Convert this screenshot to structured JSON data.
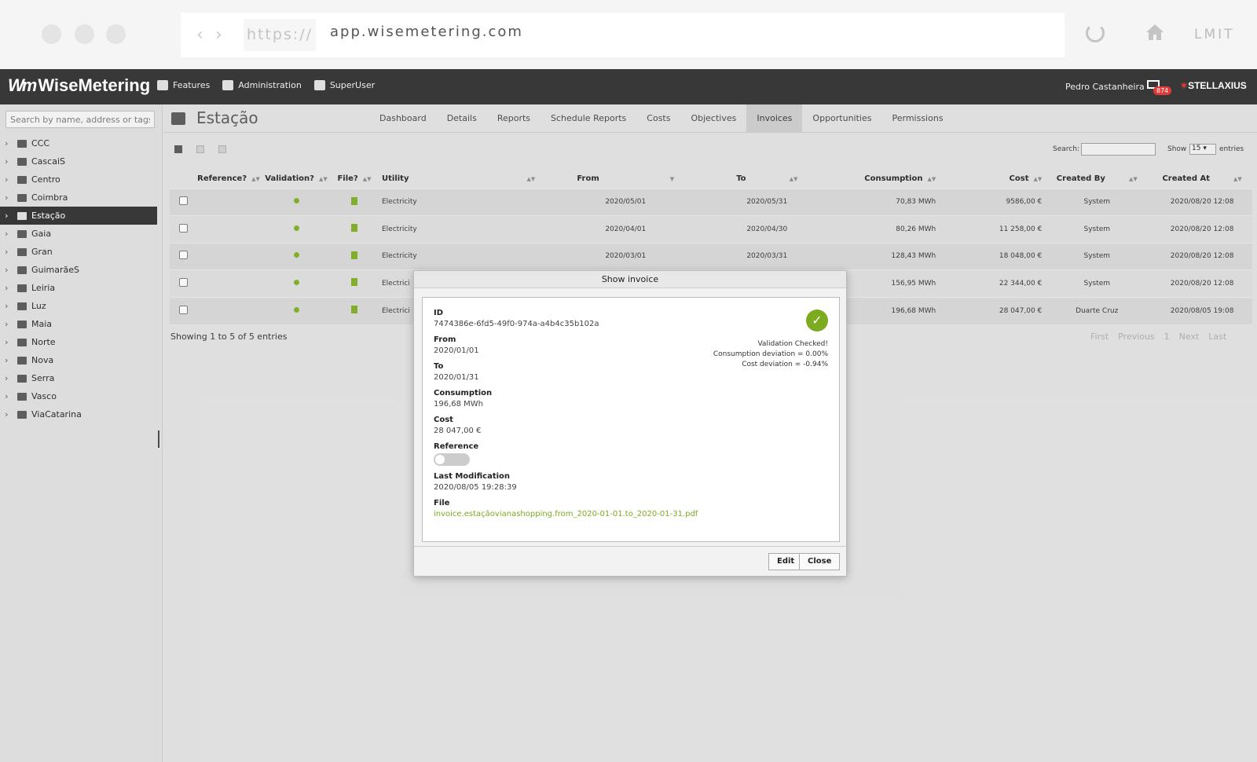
{
  "browser": {
    "protocol": "https://",
    "url": "app.wisemetering.com",
    "profile": "LMIT"
  },
  "appbar": {
    "logo": "WiseMetering",
    "logo_mark": "Wm",
    "nav": [
      {
        "label": "Features",
        "icon": "features-icon"
      },
      {
        "label": "Administration",
        "icon": "administration-icon"
      },
      {
        "label": "SuperUser",
        "icon": "superuser-icon"
      }
    ],
    "user": "Pedro Castanheira",
    "mail_count": "874",
    "brand": "STELLAXIUS"
  },
  "sidebar": {
    "search_placeholder": "Search by name, address or tags",
    "items": [
      "CCC",
      "CascaiS",
      "Centro",
      "Coimbra",
      "Estação",
      "Gaia",
      "Gran",
      "GuimarãeS",
      "Leiria",
      "Luz",
      "Maia",
      "Norte",
      "Nova",
      "Serra",
      "Vasco",
      "ViaCatarina"
    ],
    "active_item": "Estação"
  },
  "page": {
    "title": "Estação",
    "tabs": [
      "Dashboard",
      "Details",
      "Reports",
      "Schedule Reports",
      "Costs",
      "Objectives",
      "Invoices",
      "Opportunities",
      "Permissions"
    ],
    "active_tab": "Invoices"
  },
  "table": {
    "search_label": "Search:",
    "show_label": "Show",
    "show_value": "15",
    "entries_label": "entries",
    "columns": [
      "",
      "Reference?",
      "Validation?",
      "File?",
      "Utility",
      "From",
      "To",
      "Consumption",
      "Cost",
      "Created By",
      "Created At"
    ],
    "rows": [
      {
        "utility": "Electricity",
        "from": "2020/05/01",
        "to": "2020/05/31",
        "consumption": "70,83 MWh",
        "cost": "9586,00 €",
        "created_by": "System",
        "created_at": "2020/08/20 12:08"
      },
      {
        "utility": "Electricity",
        "from": "2020/04/01",
        "to": "2020/04/30",
        "consumption": "80,26 MWh",
        "cost": "11 258,00 €",
        "created_by": "System",
        "created_at": "2020/08/20 12:08"
      },
      {
        "utility": "Electricity",
        "from": "2020/03/01",
        "to": "2020/03/31",
        "consumption": "128,43 MWh",
        "cost": "18 048,00 €",
        "created_by": "System",
        "created_at": "2020/08/20 12:08"
      },
      {
        "utility": "Electrici",
        "from": "",
        "to": "",
        "consumption": "156,95 MWh",
        "cost": "22 344,00 €",
        "created_by": "System",
        "created_at": "2020/08/20 12:08"
      },
      {
        "utility": "Electrici",
        "from": "",
        "to": "",
        "consumption": "196,68 MWh",
        "cost": "28 047,00 €",
        "created_by": "Duarte Cruz",
        "created_at": "2020/08/05 19:08"
      }
    ],
    "showing": "Showing 1 to 5 of 5 entries",
    "pager": [
      "First",
      "Previous",
      "1",
      "Next",
      "Last"
    ]
  },
  "modal": {
    "title": "Show invoice",
    "id_label": "ID",
    "id_value": "7474386e-6fd5-49f0-974a-a4b4c35b102a",
    "from_label": "From",
    "from_value": "2020/01/01",
    "to_label": "To",
    "to_value": "2020/01/31",
    "consumption_label": "Consumption",
    "consumption_value": "196,68 MWh",
    "cost_label": "Cost",
    "cost_value": "28 047,00 €",
    "reference_label": "Reference",
    "last_mod_label": "Last Modification",
    "last_mod_value": "2020/08/05 19:28:39",
    "file_label": "File",
    "file_value": "invoice.estaçãovianashopping.from_2020-01-01.to_2020-01-31.pdf",
    "validation": [
      "Validation Checked!",
      "Consumption deviation = 0.00%",
      "Cost deviation = -0.94%"
    ],
    "edit_label": "Edit",
    "close_label": "Close"
  },
  "colors": {
    "accent_green": "#7cab1f",
    "appbar": "#2e2e2e",
    "badge_red": "#e03030"
  }
}
